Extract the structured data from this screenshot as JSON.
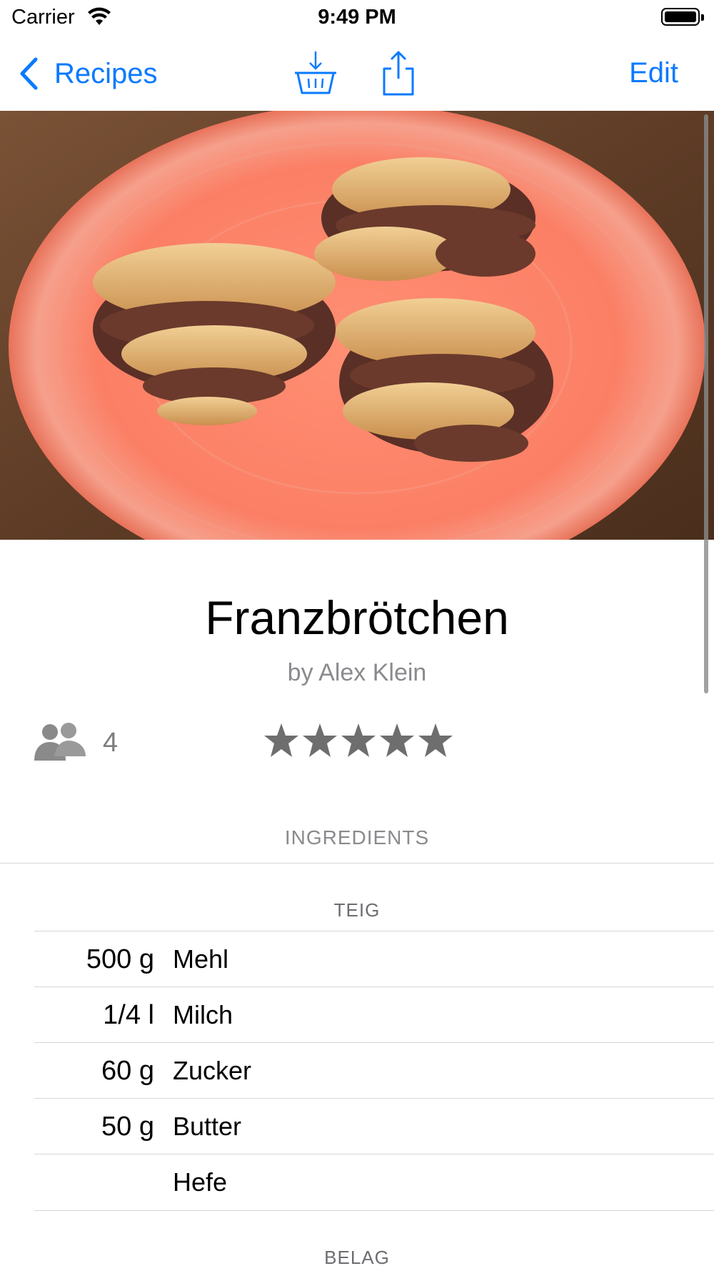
{
  "status_bar": {
    "carrier": "Carrier",
    "time": "9:49 PM"
  },
  "nav": {
    "back_label": "Recipes",
    "edit_label": "Edit"
  },
  "recipe": {
    "title": "Franzbrötchen",
    "author": "by Alex Klein",
    "servings": "4",
    "rating": 5
  },
  "ingredients": {
    "header": "INGREDIENTS",
    "groups": [
      {
        "name": "TEIG",
        "items": [
          {
            "qty": "500 g",
            "name": "Mehl"
          },
          {
            "qty": "1/4 l",
            "name": "Milch"
          },
          {
            "qty": "60 g",
            "name": "Zucker"
          },
          {
            "qty": "50 g",
            "name": "Butter"
          },
          {
            "qty": "",
            "name": "Hefe"
          }
        ]
      },
      {
        "name": "BELAG",
        "items": []
      }
    ]
  },
  "colors": {
    "accent": "#0a7aff",
    "secondary_text": "#8a8a8e",
    "star": "#6e6e6e"
  },
  "icons": {
    "back": "chevron-left-icon",
    "basket": "basket-download-icon",
    "share": "share-icon",
    "servings": "people-icon",
    "rating": "star-icon"
  }
}
